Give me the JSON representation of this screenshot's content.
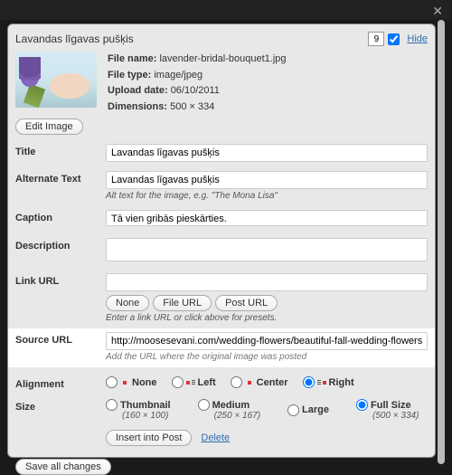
{
  "header": {
    "title": "Lavandas līgavas pušķis",
    "order": "9",
    "hide_label": "Hide"
  },
  "meta": {
    "filename_label": "File name:",
    "filename": "lavender-bridal-bouquet1.jpg",
    "filetype_label": "File type:",
    "filetype": "image/jpeg",
    "upload_label": "Upload date:",
    "upload": "06/10/2011",
    "dims_label": "Dimensions:",
    "dims": "500 × 334",
    "edit_btn": "Edit Image"
  },
  "fields": {
    "title_label": "Title",
    "title_value": "Lavandas līgavas pušķis",
    "alt_label": "Alternate Text",
    "alt_value": "Lavandas līgavas pušķis",
    "alt_hint": "Alt text for the image, e.g. \"The Mona Lisa\"",
    "caption_label": "Caption",
    "caption_value": "Tā vien gribās pieskārties.",
    "desc_label": "Description",
    "desc_value": "",
    "linkurl_label": "Link URL",
    "linkurl_value": "",
    "linkurl_hint": "Enter a link URL or click above for presets.",
    "source_label": "Source URL",
    "source_value": "http://moosesevani.com/wedding-flowers/beautiful-fall-wedding-flowers.html/attachm",
    "source_hint": "Add the URL where the original image was posted",
    "none_btn": "None",
    "fileurl_btn": "File URL",
    "posturl_btn": "Post URL"
  },
  "align": {
    "label": "Alignment",
    "none": "None",
    "left": "Left",
    "center": "Center",
    "right": "Right",
    "selected": "right"
  },
  "size": {
    "label": "Size",
    "thumb": "Thumbnail",
    "thumb_dim": "(160 × 100)",
    "med": "Medium",
    "med_dim": "(250 × 167)",
    "large": "Large",
    "full": "Full Size",
    "full_dim": "(500 × 334)",
    "selected": "full"
  },
  "actions": {
    "insert": "Insert into Post",
    "delete": "Delete",
    "save": "Save all changes"
  }
}
